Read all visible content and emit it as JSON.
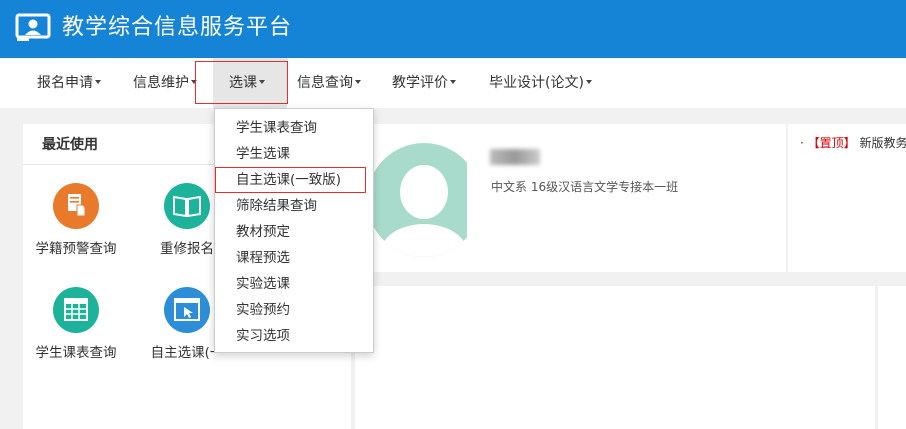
{
  "app": {
    "title": "教学综合信息服务平台"
  },
  "nav": {
    "items": [
      {
        "label": "报名申请"
      },
      {
        "label": "信息维护"
      },
      {
        "label": "选课"
      },
      {
        "label": "信息查询"
      },
      {
        "label": "教学评价"
      },
      {
        "label": "毕业设计(论文)"
      }
    ],
    "active_index": 2
  },
  "dropdown": {
    "items": [
      {
        "label": "学生课表查询"
      },
      {
        "label": "学生选课"
      },
      {
        "label": "自主选课(一致版)"
      },
      {
        "label": "筛除结果查询"
      },
      {
        "label": "教材预定"
      },
      {
        "label": "课程预选"
      },
      {
        "label": "实验选课"
      },
      {
        "label": "实验预约"
      },
      {
        "label": "实习选项"
      }
    ],
    "highlighted_index": 2
  },
  "recent": {
    "title": "最近使用",
    "tiles": [
      {
        "label": "学籍预警查询",
        "icon": "document-hand-icon",
        "color": "#e9792b"
      },
      {
        "label": "重修报名",
        "icon": "open-book-icon",
        "color": "#1db39a"
      },
      {
        "label": "学生课表查询",
        "icon": "calendar-grid-icon",
        "color": "#1db39a"
      },
      {
        "label": "自主选课(一",
        "icon": "window-cursor-icon",
        "color": "#2d8ed8"
      }
    ]
  },
  "profile": {
    "subtitle": "中文系 16级汉语言文学专接本一班"
  },
  "notice": {
    "bullet": "·",
    "tag": "【置顶】",
    "text": "新版教务"
  },
  "colors": {
    "header_bg": "#1583d6",
    "highlight_border": "#e03030",
    "avatar": "#a8dbcb"
  }
}
